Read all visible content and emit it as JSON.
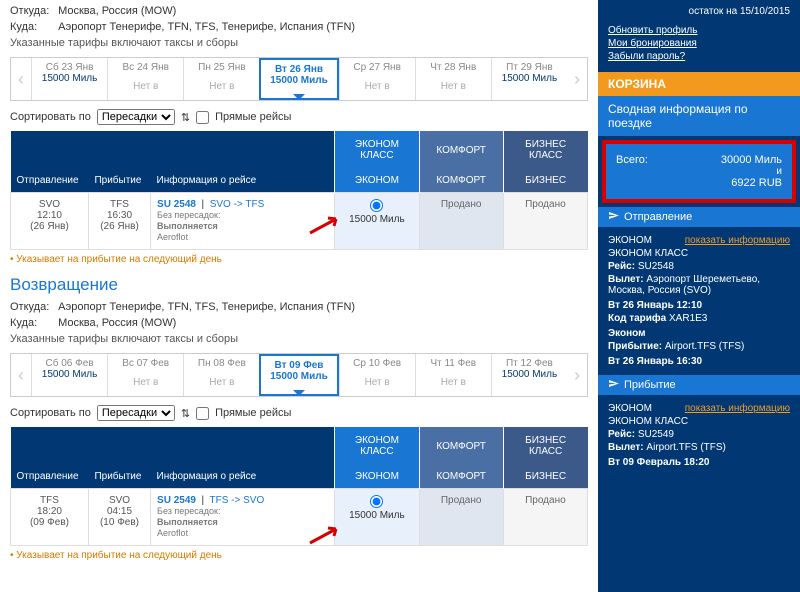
{
  "outbound": {
    "from_label": "Откуда:",
    "from": "Москва, Россия (MOW)",
    "to_label": "Куда:",
    "to": "Аэропорт Тенерифе, TFN, TFS, Тенерифе, Испания (TFN)",
    "fare_note": "Указанные тарифы включают таксы и сборы"
  },
  "dates1": [
    {
      "day": "Сб 23 Янв",
      "price": "15000 Миль",
      "sel": false,
      "na": ""
    },
    {
      "day": "Вс 24 Янв",
      "price": "",
      "sel": false,
      "na": "Нет в"
    },
    {
      "day": "Пн 25 Янв",
      "price": "",
      "sel": false,
      "na": "Нет в"
    },
    {
      "day": "Вт 26 Янв",
      "price": "15000 Миль",
      "sel": true,
      "na": ""
    },
    {
      "day": "Ср 27 Янв",
      "price": "",
      "sel": false,
      "na": "Нет в"
    },
    {
      "day": "Чт 28 Янв",
      "price": "",
      "sel": false,
      "na": "Нет в"
    },
    {
      "day": "Пт 29 Янв",
      "price": "15000 Миль",
      "sel": false,
      "na": ""
    }
  ],
  "sort": {
    "label": "Сортировать по",
    "option": "Пересадки",
    "direct": "Прямые рейсы"
  },
  "table_hdrs": {
    "dep": "Отправление",
    "arr": "Прибытие",
    "info": "Информация о рейсе",
    "econ_top": "ЭКОНОМ КЛАСС",
    "comf_top": "КОМФОРТ",
    "biz_top": "БИЗНЕС КЛАСС",
    "econ": "ЭКОНОМ",
    "comf": "КОМФОРТ",
    "biz": "БИЗНЕС"
  },
  "flight1": {
    "dep_code": "SVO",
    "dep_time": "12:10",
    "dep_date": "(26 Янв)",
    "arr_code": "TFS",
    "arr_time": "16:30",
    "arr_date": "(26 Янв)",
    "flno": "SU 2548",
    "route": "SVO -> TFS",
    "nonstop": "Без пересадок:",
    "status": "Выполняется",
    "carrier": "Aeroflot",
    "econ_price": "15000  Миль",
    "comf": "Продано",
    "biz": "Продано"
  },
  "footnote": "Указывает на прибытие на следующий день",
  "return_title": "Возвращение",
  "inbound": {
    "from_label": "Откуда:",
    "from": "Аэропорт Тенерифе, TFN, TFS, Тенерифе, Испания (TFN)",
    "to_label": "Куда:",
    "to": "Москва, Россия (MOW)",
    "fare_note": "Указанные тарифы включают таксы и сборы"
  },
  "dates2": [
    {
      "day": "Сб 06 Фев",
      "price": "15000 Миль",
      "sel": false,
      "na": ""
    },
    {
      "day": "Вс 07 Фев",
      "price": "",
      "sel": false,
      "na": "Нет в"
    },
    {
      "day": "Пн 08 Фев",
      "price": "",
      "sel": false,
      "na": "Нет в"
    },
    {
      "day": "Вт 09 Фев",
      "price": "15000 Миль",
      "sel": true,
      "na": ""
    },
    {
      "day": "Ср 10 Фев",
      "price": "",
      "sel": false,
      "na": "Нет в"
    },
    {
      "day": "Чт 11 Фев",
      "price": "",
      "sel": false,
      "na": "Нет в"
    },
    {
      "day": "Пт 12 Фев",
      "price": "15000 Миль",
      "sel": false,
      "na": ""
    }
  ],
  "flight2": {
    "dep_code": "TFS",
    "dep_time": "18:20",
    "dep_date": "(09 Фев)",
    "arr_code": "SVO",
    "arr_time": "04:15",
    "arr_date": "(10 Фев)",
    "flno": "SU 2549",
    "route": "TFS -> SVO",
    "nonstop": "Без пересадок:",
    "status": "Выполняется",
    "carrier": "Aeroflot",
    "econ_price": "15000  Миль",
    "comf": "Продано",
    "biz": "Продано"
  },
  "sidebar": {
    "balance": "остаток на 15/10/2015",
    "links": [
      "Обновить профиль",
      "Мои бронирования",
      "Забыли пароль?"
    ],
    "basket": "КОРЗИНА",
    "summary_hdr": "Сводная информация по поездке",
    "total_label": "Всего:",
    "total_miles": "30000  Миль",
    "and": "и",
    "total_rub": "6922 RUB",
    "dep_hdr": "Отправление",
    "seg1": {
      "class1": "ЭКОНОМ",
      "show": "показать информацию",
      "class2": "ЭКОНОМ КЛАСС",
      "flight_lbl": "Рейс:",
      "flight": "SU2548",
      "dep_lbl": "Вылет:",
      "dep": "Аэропорт Шереметьево, Москва, Россия (SVO)",
      "dt1": "Вт 26 Январь 12:10",
      "tariff_lbl": "Код тарифа",
      "tariff": "XAR1E3",
      "cabin": "Эконом",
      "arr_lbl": "Прибытие:",
      "arr": "Airport.TFS (TFS)",
      "dt2": "Вт 26 Январь 16:30"
    },
    "arr_hdr": "Прибытие",
    "seg2": {
      "class1": "ЭКОНОМ",
      "show": "показать информацию",
      "class2": "ЭКОНОМ КЛАСС",
      "flight_lbl": "Рейс:",
      "flight": "SU2549",
      "dep_lbl": "Вылет:",
      "dep": "Airport.TFS (TFS)",
      "dt1": "Вт 09 Февраль 18:20"
    }
  }
}
